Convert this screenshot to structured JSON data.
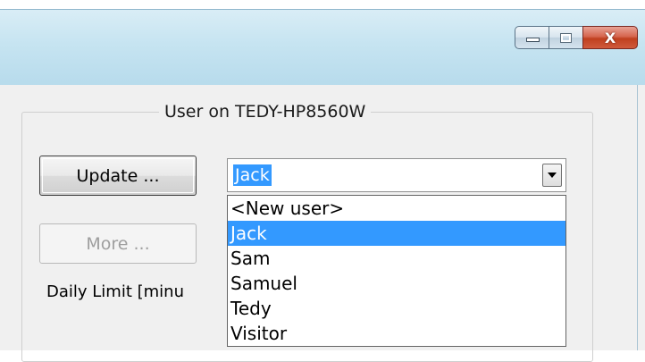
{
  "window": {
    "controls": {
      "minimize_icon": "minimize-icon",
      "maximize_icon": "maximize-icon",
      "close_glyph": "X"
    }
  },
  "group": {
    "title": "User on TEDY-HP8560W"
  },
  "buttons": {
    "update": "Update ...",
    "more": "More ..."
  },
  "combo": {
    "value": "Jack"
  },
  "dropdown": {
    "items": [
      "<New user>",
      "Jack",
      "Sam",
      "Samuel",
      "Tedy",
      "Visitor"
    ],
    "selected": "Jack"
  },
  "labels": {
    "daily_limit": "Daily Limit [minu"
  },
  "colors": {
    "selection": "#3399ff",
    "titlebar": "#c6e4f1",
    "close": "#d6664f"
  }
}
